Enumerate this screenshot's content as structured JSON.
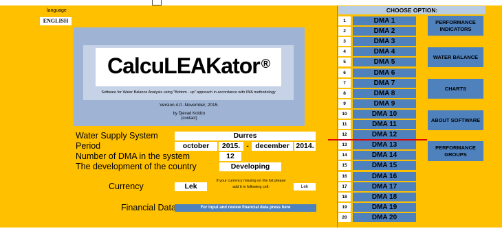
{
  "language": {
    "label": "language",
    "value": "ENGLISH"
  },
  "logo": {
    "title": "CalcuLEAKator",
    "registered": "®",
    "subtitle": "Software for Water Balance Analysis using \"Bottom - up\" approach in accordance with IWA methodology",
    "version": "Version 4.0 -November, 2015.",
    "author": "by Djevad Koldzo",
    "contact": "(contact)"
  },
  "form": {
    "water_supply_label": "Water Supply System",
    "water_supply_value": "Durres",
    "period_label": "Period",
    "period_start_month": "october",
    "period_start_year": "2015.",
    "period_separator": "-",
    "period_end_month": "december",
    "period_end_year": "2014.",
    "dma_count_label": "Number of DMA in the system",
    "dma_count_value": "12",
    "development_label": "The development of the country",
    "development_value": "Developing",
    "currency_label": "Currency",
    "currency_value": "Lek",
    "currency_note": "If your currency missing on the list please add it in following cell:",
    "currency_custom": "Lek",
    "financial_label": "Financial Data",
    "financial_button": "For input and review financial data press here"
  },
  "right_panel": {
    "header": "CHOOSE OPTION:",
    "dma_rows": [
      {
        "num": "1",
        "label": "DMA 1"
      },
      {
        "num": "2",
        "label": "DMA 2"
      },
      {
        "num": "3",
        "label": "DMA 3"
      },
      {
        "num": "4",
        "label": "DMA 4"
      },
      {
        "num": "5",
        "label": "DMA 5"
      },
      {
        "num": "6",
        "label": "DMA 6"
      },
      {
        "num": "7",
        "label": "DMA 7"
      },
      {
        "num": "8",
        "label": "DMA 8"
      },
      {
        "num": "9",
        "label": "DMA 9"
      },
      {
        "num": "10",
        "label": "DMA 10"
      },
      {
        "num": "11",
        "label": "DMA 11"
      },
      {
        "num": "12",
        "label": "DMA 12"
      },
      {
        "num": "13",
        "label": "DMA 13"
      },
      {
        "num": "14",
        "label": "DMA 14"
      },
      {
        "num": "15",
        "label": "DMA 15"
      },
      {
        "num": "16",
        "label": "DMA 16"
      },
      {
        "num": "17",
        "label": "DMA 17"
      },
      {
        "num": "18",
        "label": "DMA 18"
      },
      {
        "num": "19",
        "label": "DMA 19"
      },
      {
        "num": "20",
        "label": "DMA 20"
      }
    ],
    "options": {
      "performance_indicators": "PERFORMANCE INDICATORS",
      "water_balance": "WATER BALANCE",
      "charts": "CHARTS",
      "about_software": "ABOUT SOFTWARE",
      "performance_groups": "PERFORMANCE GROUPS"
    }
  },
  "colors": {
    "background": "#ffc000",
    "button": "#4f81bd",
    "header": "#b8cce4",
    "marker": "#e00000"
  }
}
